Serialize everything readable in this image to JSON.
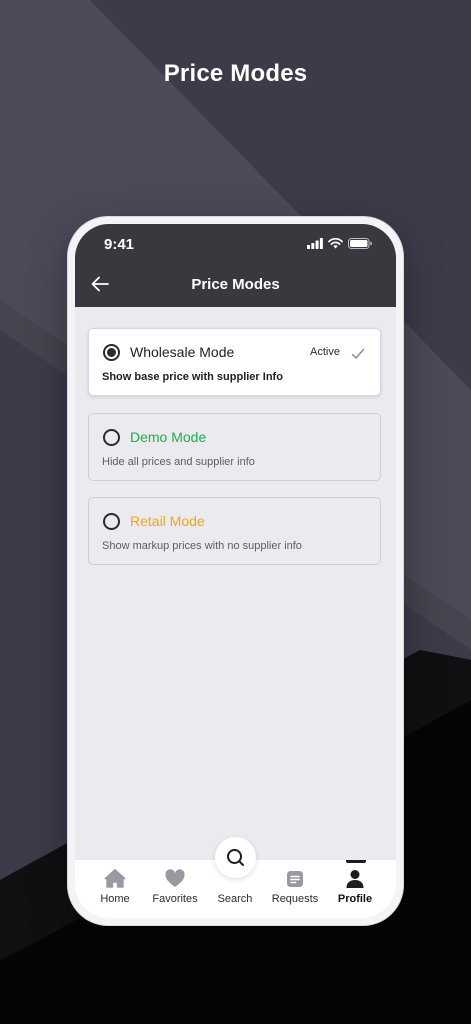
{
  "hero": {
    "title": "Price Modes"
  },
  "status_bar": {
    "time": "9:41"
  },
  "header": {
    "title": "Price Modes"
  },
  "modes": [
    {
      "title": "Wholesale Mode",
      "description": "Show base price with supplier Info",
      "badge": "Active",
      "selected": true,
      "color": "#1f1e25"
    },
    {
      "title": "Demo Mode",
      "description": "Hide all prices and supplier info",
      "selected": false,
      "color": "#1fae4d"
    },
    {
      "title": "Retail Mode",
      "description": "Show markup prices with no supplier info",
      "selected": false,
      "color": "#f2a51c"
    }
  ],
  "tabbar": {
    "items": [
      {
        "label": "Home",
        "icon": "home-icon"
      },
      {
        "label": "Favorites",
        "icon": "heart-icon"
      },
      {
        "label": "Search",
        "icon": "search-icon"
      },
      {
        "label": "Requests",
        "icon": "list-icon"
      },
      {
        "label": "Profile",
        "icon": "user-icon",
        "active": true
      }
    ]
  },
  "colors": {
    "header_bg": "#39383f",
    "screen_bg": "#ebeaef",
    "demo_accent": "#1fae4d",
    "retail_accent": "#f2a51c"
  }
}
